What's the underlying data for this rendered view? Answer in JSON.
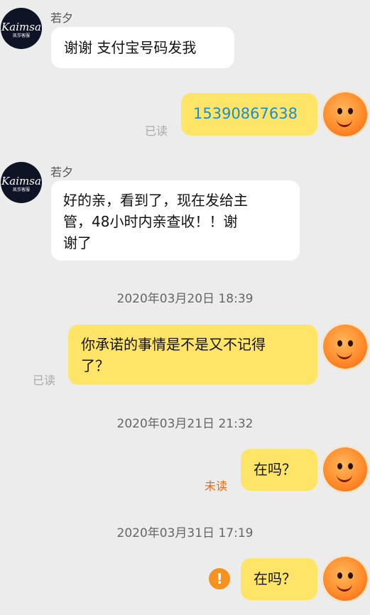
{
  "messages": [
    {
      "side": "left",
      "sender": "若夕",
      "text": "谢谢 支付宝号码发我"
    },
    {
      "side": "right",
      "text": "15390867638",
      "status": "已读"
    },
    {
      "side": "left",
      "sender": "若夕",
      "text": "好的亲，看到了，现在发给主管，48小时内亲查收！！谢谢了"
    },
    {
      "timestamp": "2020年03月20日 18:39"
    },
    {
      "side": "right",
      "text": "你承诺的事情是不是又不记得了？",
      "status": "已读"
    },
    {
      "timestamp": "2020年03月21日 21:32"
    },
    {
      "side": "right",
      "text": "在吗？",
      "status": "未读"
    },
    {
      "timestamp": "2020年03月31日 17:19"
    },
    {
      "side": "right",
      "text": "在吗？",
      "status": "send-failed"
    }
  ],
  "avatar_left": {
    "logo_main": "Kaimsa",
    "logo_sub": "凯莎客服"
  },
  "bubble_lines": {
    "m3": [
      "好的亲，看到了，现在发给主",
      "管，48小时内亲查收！！谢",
      "谢了"
    ],
    "m5": [
      "你承诺的事情是不是又不记得",
      "了？"
    ]
  },
  "fail_icon": "!",
  "colors": {
    "bubble_mine": "#ffe567",
    "bubble_theirs": "#ffffff",
    "background": "#ececec",
    "phone_link": "#1b8ed2",
    "unread": "#e86a14"
  }
}
